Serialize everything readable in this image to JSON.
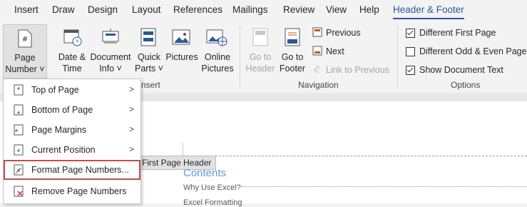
{
  "tabs": [
    "Insert",
    "Draw",
    "Design",
    "Layout",
    "References",
    "Mailings",
    "Review",
    "View",
    "Help",
    "Header & Footer"
  ],
  "ribbon": {
    "page_number": {
      "line1": "Page",
      "line2": "Number ˅"
    },
    "date_time": {
      "line1": "Date &",
      "line2": "Time"
    },
    "document_info": {
      "line1": "Document",
      "line2": "Info ˅"
    },
    "quick_parts": {
      "line1": "Quick",
      "line2": "Parts ˅"
    },
    "pictures": {
      "line1": "Pictures"
    },
    "online_pictures": {
      "line1": "Online",
      "line2": "Pictures"
    },
    "go_to_header": {
      "line1": "Go to",
      "line2": "Header"
    },
    "go_to_footer": {
      "line1": "Go to",
      "line2": "Footer"
    },
    "previous": "Previous",
    "next": "Next",
    "link_to_previous": "Link to Previous",
    "different_first_page": "Different First Page",
    "different_odd_even": "Different Odd & Even Pages",
    "show_document_text": "Show Document Text",
    "group_insert_partial": "nsert",
    "group_navigation": "Navigation",
    "group_options": "Options",
    "group_left_partial": "F"
  },
  "options_state": {
    "different_first_page": true,
    "different_odd_even": false,
    "show_document_text": true
  },
  "menu": {
    "items": [
      {
        "label": "Top of Page",
        "submenu": true
      },
      {
        "label": "Bottom of Page",
        "submenu": true
      },
      {
        "label": "Page Margins",
        "submenu": true
      },
      {
        "label": "Current Position",
        "submenu": true
      },
      {
        "label": "Format Page Numbers...",
        "submenu": false
      },
      {
        "label": "Remove Page Numbers",
        "submenu": false
      }
    ],
    "arrow": ">"
  },
  "document": {
    "header_tag": "First Page Header",
    "contents_title": "Contents",
    "toc_1": "Why Use Excel?",
    "toc_2": "Excel Formatting"
  },
  "colors": {
    "accent": "#2b579a",
    "highlight_border": "#c0504d",
    "heading": "#5b9bd5"
  }
}
